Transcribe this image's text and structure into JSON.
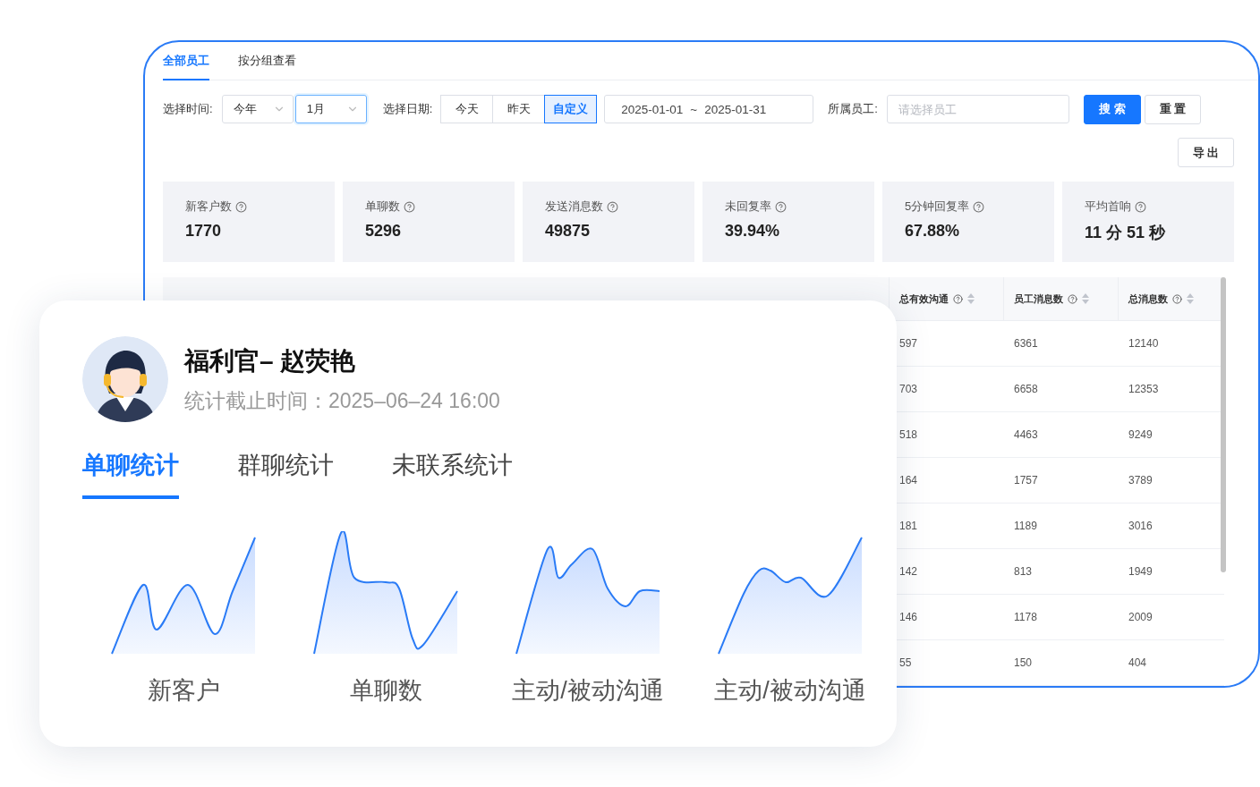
{
  "panel": {
    "tabs": [
      {
        "label": "全部员工",
        "selected": true
      },
      {
        "label": "按分组查看",
        "selected": false
      }
    ],
    "filters": {
      "time_label": "选择时间:",
      "year_select": "今年",
      "month_select": "1月",
      "date_label": "选择日期:",
      "date_options": [
        {
          "label": "今天",
          "selected": false
        },
        {
          "label": "昨天",
          "selected": false
        },
        {
          "label": "自定义",
          "selected": true
        }
      ],
      "date_range": {
        "start": "2025-01-01",
        "separator": "~",
        "end": "2025-01-31"
      },
      "staff_label": "所属员工:",
      "staff_placeholder": "请选择员工",
      "search_button": "搜 索",
      "reset_button": "重 置"
    },
    "export_button": "导 出",
    "stats": [
      {
        "label": "新客户数",
        "value": "1770"
      },
      {
        "label": "单聊数",
        "value": "5296"
      },
      {
        "label": "发送消息数",
        "value": "49875"
      },
      {
        "label": "未回复率",
        "value": "39.94%"
      },
      {
        "label": "5分钟回复率",
        "value": "67.88%"
      },
      {
        "label": "平均首响",
        "value": "11 分 51 秒"
      }
    ],
    "table": {
      "columns": [
        {
          "label": "总有效沟通"
        },
        {
          "label": "员工消息数"
        },
        {
          "label": "总消息数"
        }
      ],
      "rows": [
        [
          "597",
          "6361",
          "12140"
        ],
        [
          "703",
          "6658",
          "12353"
        ],
        [
          "518",
          "4463",
          "9249"
        ],
        [
          "164",
          "1757",
          "3789"
        ],
        [
          "181",
          "1189",
          "3016"
        ],
        [
          "142",
          "813",
          "1949"
        ],
        [
          "146",
          "1178",
          "2009"
        ],
        [
          "55",
          "150",
          "404"
        ]
      ]
    }
  },
  "card": {
    "name": "福利官– 赵荧艳",
    "subtitle": "统计截止时间：2025–06–24 16:00",
    "tabs": [
      {
        "label": "单聊统计",
        "selected": true
      },
      {
        "label": "群聊统计",
        "selected": false
      },
      {
        "label": "未联系统计",
        "selected": false
      }
    ],
    "charts": [
      {
        "label": "新客户"
      },
      {
        "label": "单聊数"
      },
      {
        "label": "主动/被动沟通"
      },
      {
        "label": "主动/被动沟通"
      }
    ]
  }
}
